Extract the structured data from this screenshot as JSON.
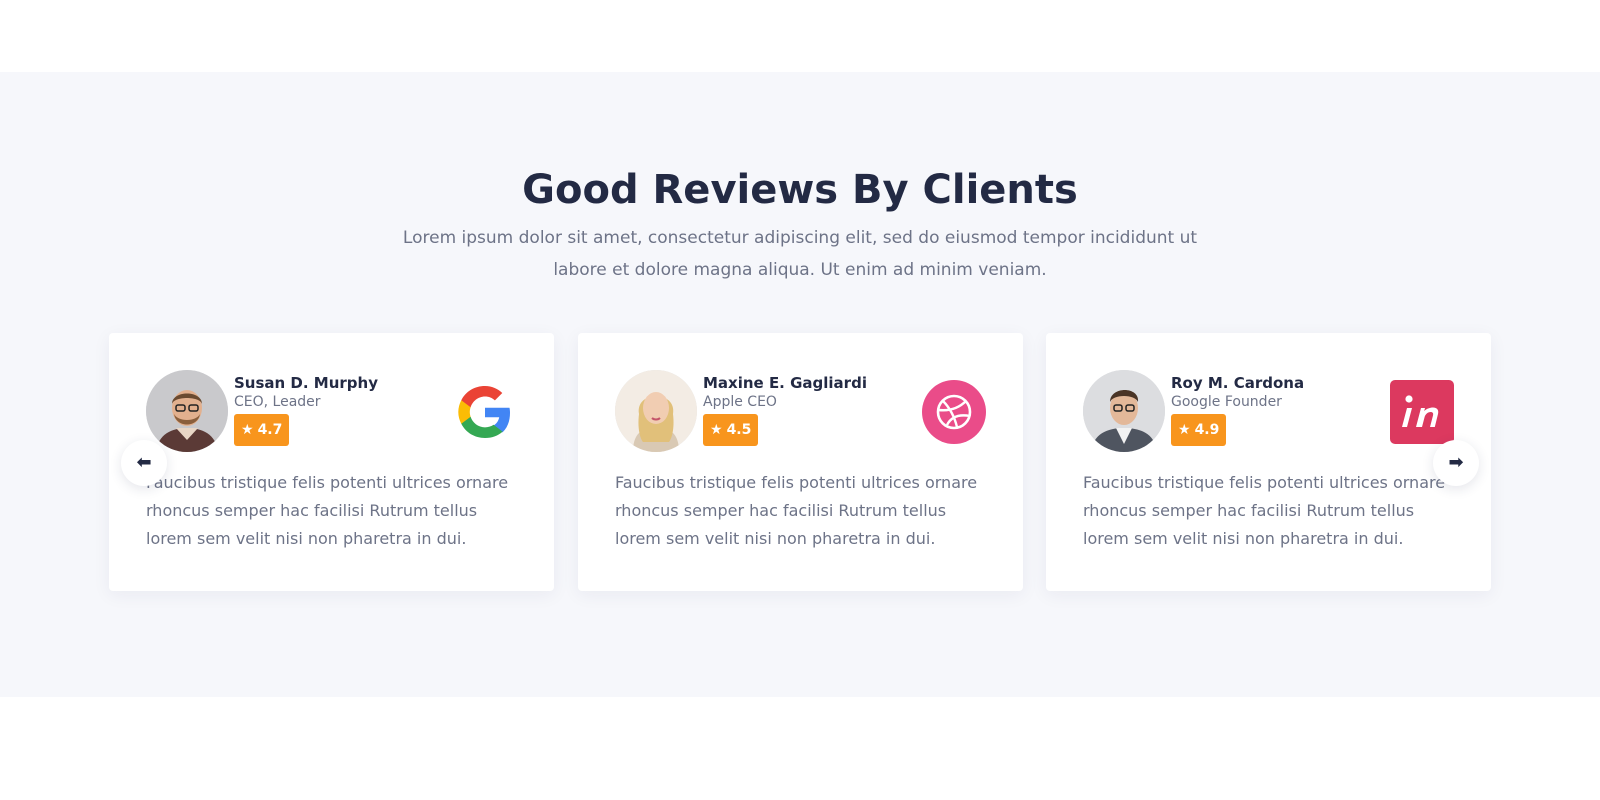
{
  "reviews_section": {
    "title": "Good Reviews By Clients",
    "subtitle": "Lorem ipsum dolor sit amet, consectetur adipiscing elit, sed do eiusmod tempor incididunt ut labore et dolore magna aliqua. Ut enim ad minim veniam.",
    "testimonials": [
      {
        "name": "Susan D. Murphy",
        "role": "CEO, Leader",
        "rating": "4.7",
        "brand_icon": "google-icon",
        "text": "Faucibus tristique felis potenti ultrices ornare rhoncus semper hac facilisi Rutrum tellus lorem sem velit nisi non pharetra in dui."
      },
      {
        "name": "Maxine E. Gagliardi",
        "role": "Apple CEO",
        "rating": "4.5",
        "brand_icon": "dribbble-icon",
        "text": "Faucibus tristique felis potenti ultrices ornare rhoncus semper hac facilisi Rutrum tellus lorem sem velit nisi non pharetra in dui."
      },
      {
        "name": "Roy M. Cardona",
        "role": "Google Founder",
        "rating": "4.9",
        "brand_icon": "invision-icon",
        "text": "Faucibus tristique felis potenti ultrices ornare rhoncus semper hac facilisi Rutrum tellus lorem sem velit nisi non pharetra in dui."
      }
    ],
    "carousel": {
      "prev_icon": "arrow-left-icon",
      "next_icon": "arrow-right-icon"
    }
  },
  "colors": {
    "heading": "#232a44",
    "body_text": "#6d7387",
    "rating_badge": "#f8951d",
    "section_background": "#f6f7fb",
    "dribbble": "#ea4c89",
    "invision": "#dc395f"
  }
}
